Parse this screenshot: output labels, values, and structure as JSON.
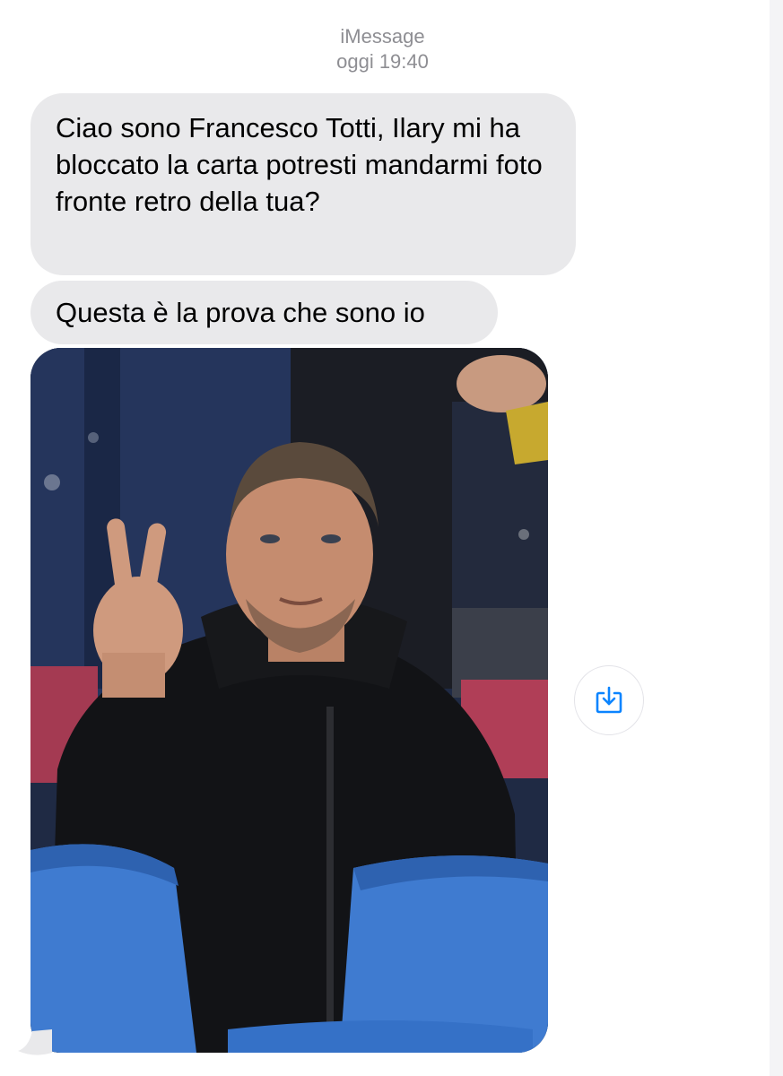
{
  "conversation": {
    "service": "iMessage",
    "timestamp": "oggi 19:40"
  },
  "messages": [
    {
      "text": "Ciao sono Francesco Totti, Ilary mi ha bloccato la carta potresti mandarmi foto fronte retro della tua?"
    },
    {
      "text": "Questa è la prova che sono io"
    }
  ],
  "attachment": {
    "type": "photo",
    "subject": "man in black hooded jacket making peace sign in stadium seats",
    "save_icon": "save-to-photos-icon"
  },
  "colors": {
    "bubble_incoming": "#e9e9eb",
    "meta_text": "#8e8e93",
    "accent": "#0a84ff"
  }
}
